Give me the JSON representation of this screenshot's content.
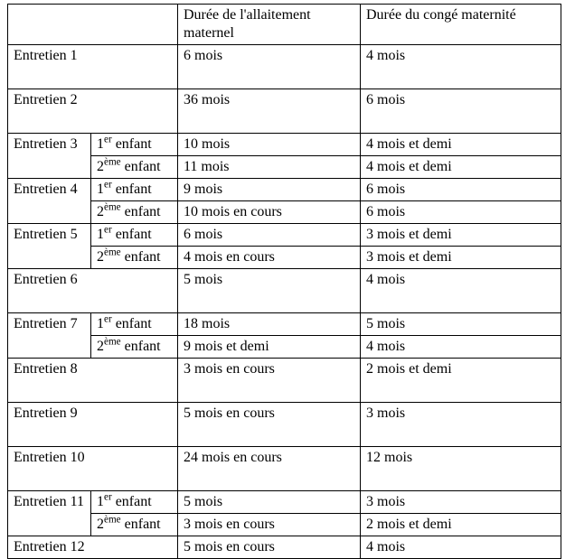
{
  "chart_data": {
    "type": "table",
    "title": "",
    "columns": [
      "",
      "Durée de l'allaitement maternel",
      "Durée du congé maternité"
    ],
    "rows": [
      {
        "interview": "Entretien 1",
        "children": [
          {
            "child": "",
            "breastfeeding": "6 mois",
            "leave": "4 mois"
          }
        ]
      },
      {
        "interview": "Entretien 2",
        "children": [
          {
            "child": "",
            "breastfeeding": "36 mois",
            "leave": "6 mois"
          }
        ]
      },
      {
        "interview": "Entretien 3",
        "children": [
          {
            "child": "1er enfant",
            "breastfeeding": "10 mois",
            "leave": "4 mois et demi"
          },
          {
            "child": "2ème enfant",
            "breastfeeding": "11 mois",
            "leave": "4 mois et demi"
          }
        ]
      },
      {
        "interview": "Entretien 4",
        "children": [
          {
            "child": "1er enfant",
            "breastfeeding": "9 mois",
            "leave": "6 mois"
          },
          {
            "child": "2ème enfant",
            "breastfeeding": "10 mois en cours",
            "leave": "6 mois"
          }
        ]
      },
      {
        "interview": "Entretien 5",
        "children": [
          {
            "child": "1er enfant",
            "breastfeeding": "6 mois",
            "leave": "3 mois et demi"
          },
          {
            "child": "2ème enfant",
            "breastfeeding": "4 mois en cours",
            "leave": "3 mois et demi"
          }
        ]
      },
      {
        "interview": "Entretien 6",
        "children": [
          {
            "child": "",
            "breastfeeding": "5 mois",
            "leave": "4 mois"
          }
        ]
      },
      {
        "interview": "Entretien 7",
        "children": [
          {
            "child": "1er enfant",
            "breastfeeding": "18 mois",
            "leave": "5 mois"
          },
          {
            "child": "2ème enfant",
            "breastfeeding": "9 mois et demi",
            "leave": "4 mois"
          }
        ]
      },
      {
        "interview": "Entretien 8",
        "children": [
          {
            "child": "",
            "breastfeeding": "3 mois en cours",
            "leave": "2 mois et demi"
          }
        ]
      },
      {
        "interview": "Entretien 9",
        "children": [
          {
            "child": "",
            "breastfeeding": "5 mois en cours",
            "leave": "3 mois"
          }
        ]
      },
      {
        "interview": "Entretien 10",
        "children": [
          {
            "child": "",
            "breastfeeding": "24 mois en cours",
            "leave": "12 mois"
          }
        ]
      },
      {
        "interview": "Entretien 11",
        "children": [
          {
            "child": "1er enfant",
            "breastfeeding": "5 mois",
            "leave": "3 mois"
          },
          {
            "child": "2ème enfant",
            "breastfeeding": "3 mois en cours",
            "leave": "2 mois et demi"
          }
        ]
      },
      {
        "interview": "Entretien 12",
        "children": [
          {
            "child": "",
            "breastfeeding": "5 mois en cours",
            "leave": "4 mois"
          }
        ]
      }
    ]
  },
  "headers": {
    "blank": "",
    "breastfeeding": "Durée de l'allaitement maternel",
    "leave": "Durée du congé maternité"
  },
  "labels": {
    "e1": "Entretien 1",
    "e2": "Entretien 2",
    "e3": "Entretien 3",
    "e4": "Entretien 4",
    "e5": "Entretien 5",
    "e6": "Entretien 6",
    "e7": "Entretien 7",
    "e8": "Entretien 8",
    "e9": "Entretien 9",
    "e10": "Entretien 10",
    "e11": "Entretien 11",
    "e12": "Entretien 12",
    "c1_pre": "1",
    "c1_sup": "er",
    "c1_post": " enfant",
    "c2_pre": "2",
    "c2_sup": "ème",
    "c2_post": " enfant"
  },
  "cells": {
    "e1_bf": "6 mois",
    "e1_lv": "4 mois",
    "e2_bf": "36 mois",
    "e2_lv": "6 mois",
    "e3a_bf": "10 mois",
    "e3a_lv": "4 mois et demi",
    "e3b_bf": "11 mois",
    "e3b_lv": "4 mois et demi",
    "e4a_bf": "9 mois",
    "e4a_lv": "6 mois",
    "e4b_bf": "10 mois en cours",
    "e4b_lv": "6 mois",
    "e5a_bf": "6 mois",
    "e5a_lv": "3 mois et demi",
    "e5b_bf": "4 mois en cours",
    "e5b_lv": "3 mois et demi",
    "e6_bf": "5 mois",
    "e6_lv": "4 mois",
    "e7a_bf": "18 mois",
    "e7a_lv": "5 mois",
    "e7b_bf": "9 mois et demi",
    "e7b_lv": "4 mois",
    "e8_bf": "3 mois en cours",
    "e8_lv": "2 mois et demi",
    "e9_bf": "5 mois en cours",
    "e9_lv": "3 mois",
    "e10_bf": "24 mois en cours",
    "e10_lv": "12 mois",
    "e11a_bf": "5 mois",
    "e11a_lv": "3 mois",
    "e11b_bf": "3 mois en cours",
    "e11b_lv": "2 mois et demi",
    "e12_bf": "5 mois en cours",
    "e12_lv": "4 mois"
  }
}
